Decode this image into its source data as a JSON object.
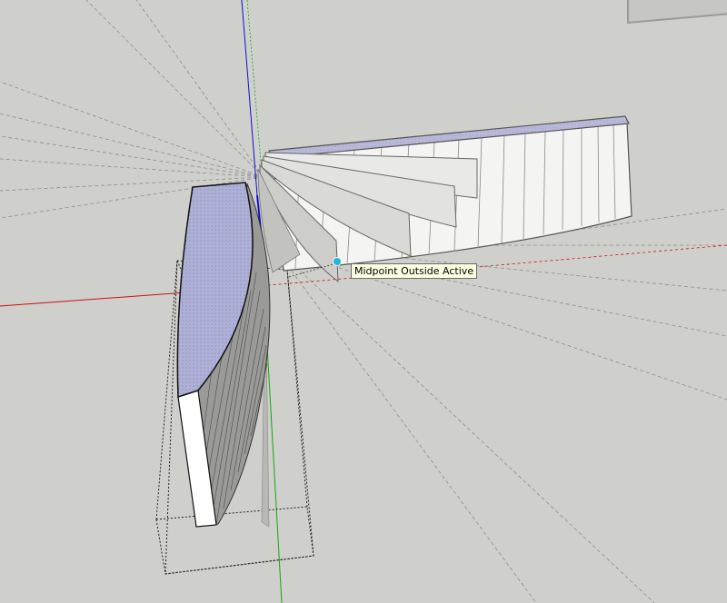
{
  "app": {
    "background_color": "#cfcfcb"
  },
  "tooltip": {
    "text": "Midpoint Outside Active",
    "marker_color": "#28b4d2"
  },
  "axes": {
    "red": "#cc1111",
    "green": "#11aa11",
    "blue": "#1111cc"
  }
}
